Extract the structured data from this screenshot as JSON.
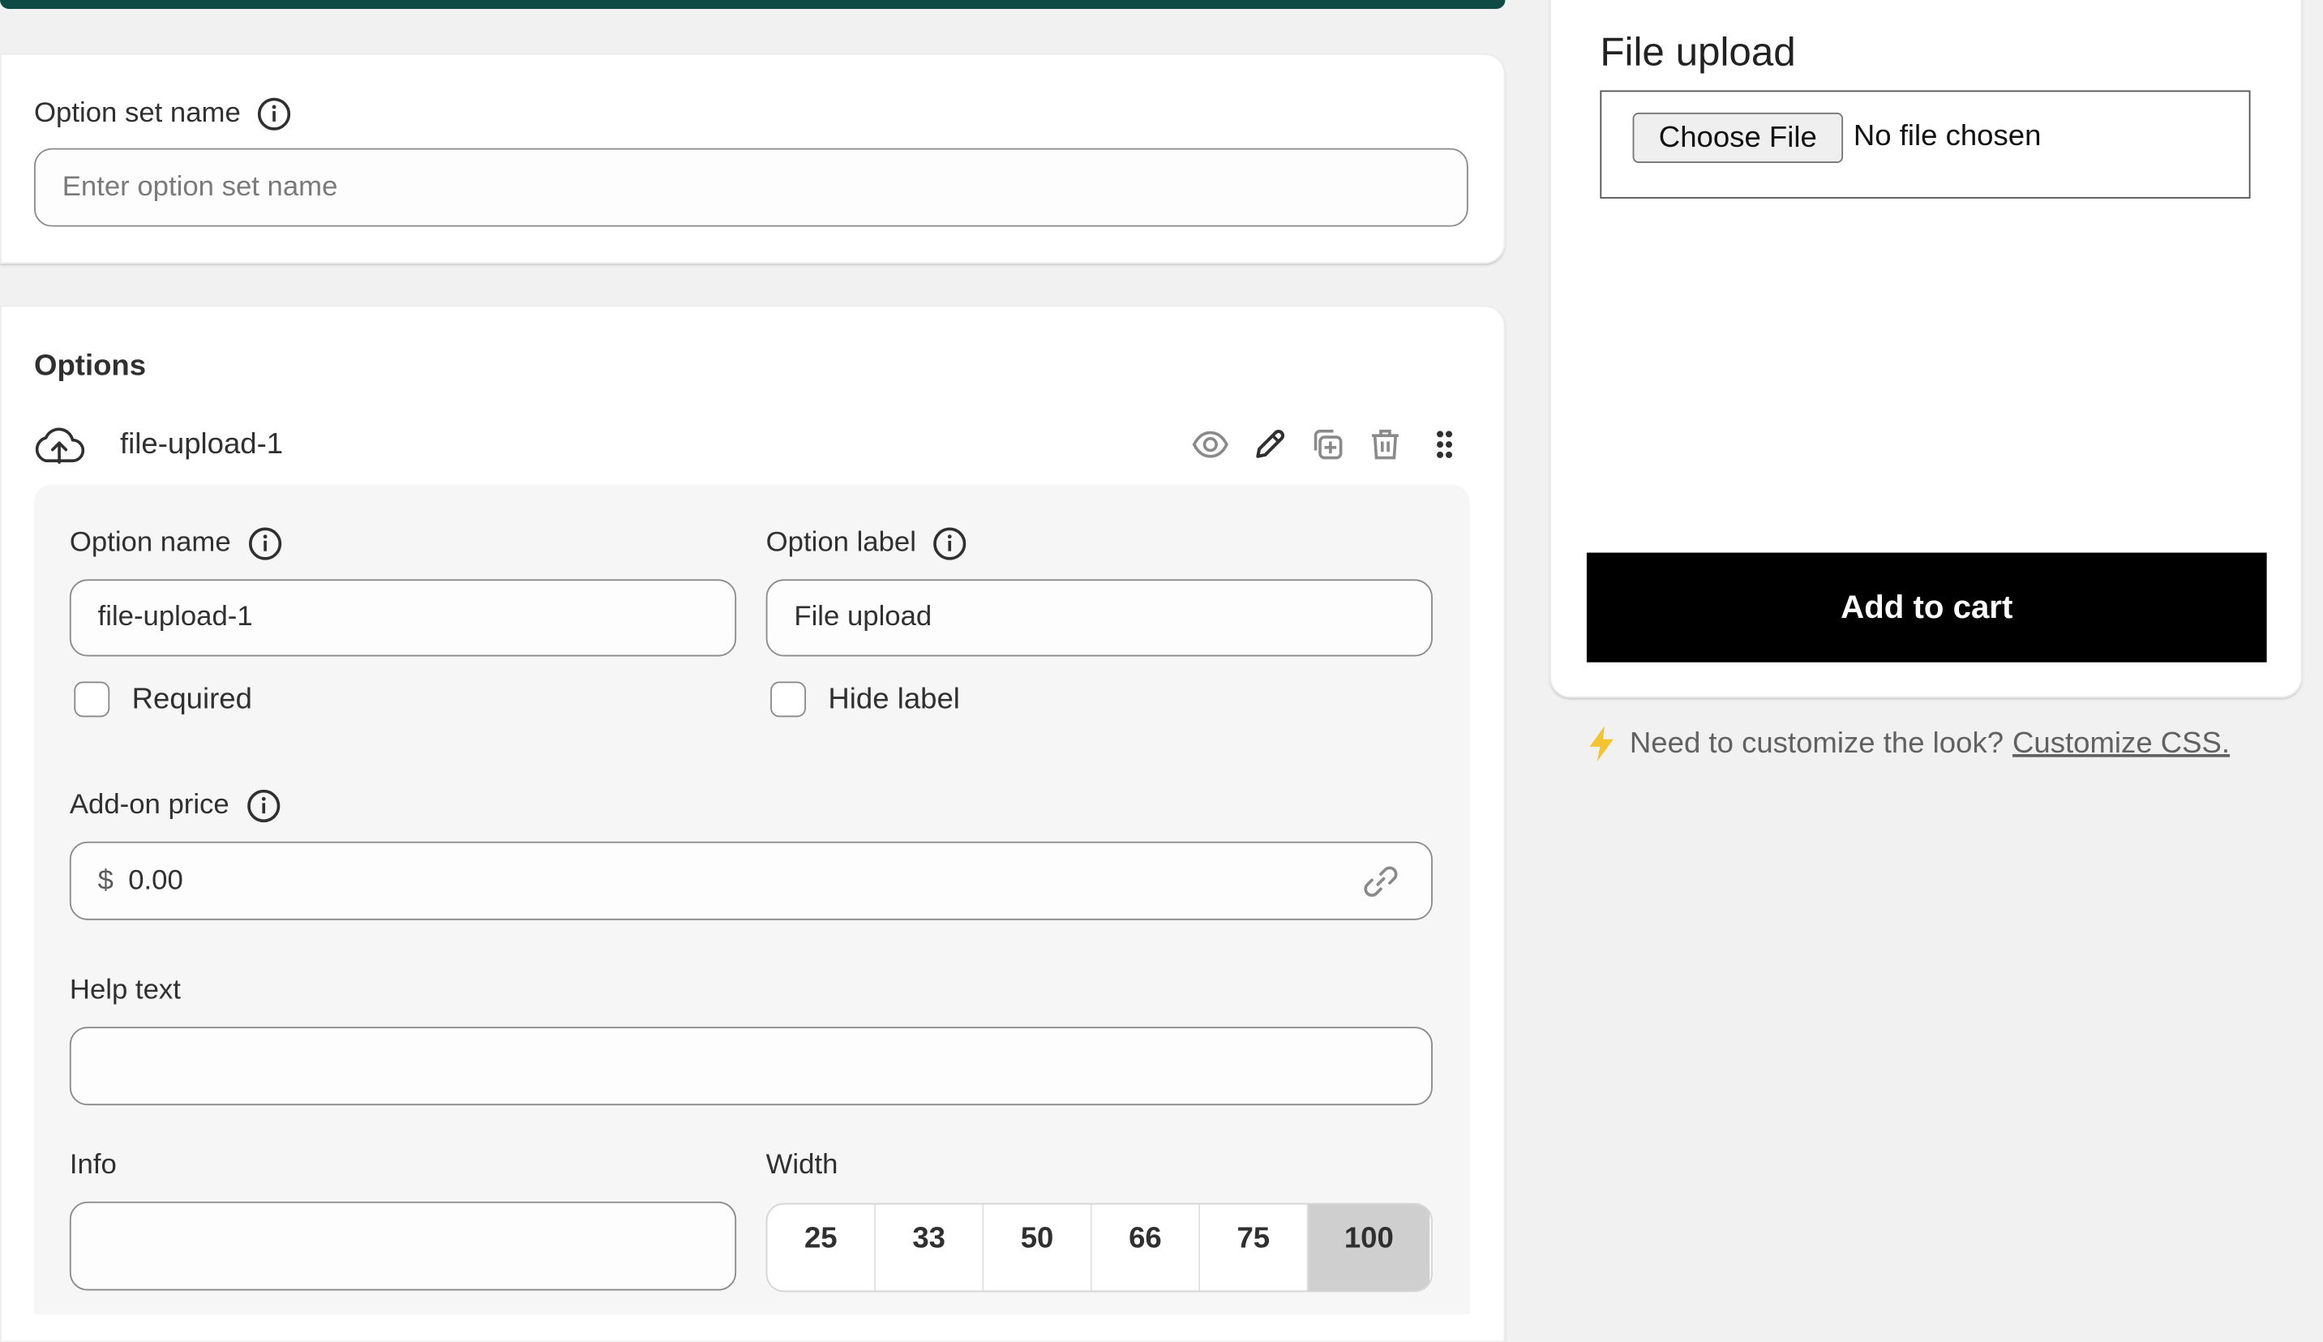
{
  "option_set": {
    "name_label": "Option set name",
    "name_placeholder": "Enter option set name"
  },
  "options": {
    "heading": "Options",
    "item": {
      "name": "file-upload-1",
      "type_icon": "upload-cloud-icon",
      "actions": [
        "eye-icon",
        "pencil-icon",
        "duplicate-icon",
        "trash-icon",
        "drag-handle-icon"
      ]
    },
    "form": {
      "option_name_label": "Option name",
      "option_name_value": "file-upload-1",
      "option_label_label": "Option label",
      "option_label_value": "File upload",
      "required_label": "Required",
      "required_checked": false,
      "hide_label_label": "Hide label",
      "hide_label_checked": false,
      "addon_price_label": "Add-on price",
      "currency_symbol": "$",
      "addon_price_value": "0.00",
      "help_text_label": "Help text",
      "help_text_value": "",
      "info_label": "Info",
      "info_value": "",
      "width_label": "Width",
      "width_options": [
        "25",
        "33",
        "50",
        "66",
        "75",
        "100"
      ],
      "width_selected": "100"
    }
  },
  "preview": {
    "field_label": "File upload",
    "choose_file_button": "Choose File",
    "no_file_text": "No file chosen",
    "add_to_cart_button": "Add to cart"
  },
  "customize": {
    "prompt": "Need to customize the look?",
    "link": "Customize CSS."
  },
  "colors": {
    "accent_bar": "#0e4b45",
    "add_to_cart_bg": "#000000",
    "bolt": "#f4c430",
    "selected_width_bg": "#cfcfcf"
  }
}
